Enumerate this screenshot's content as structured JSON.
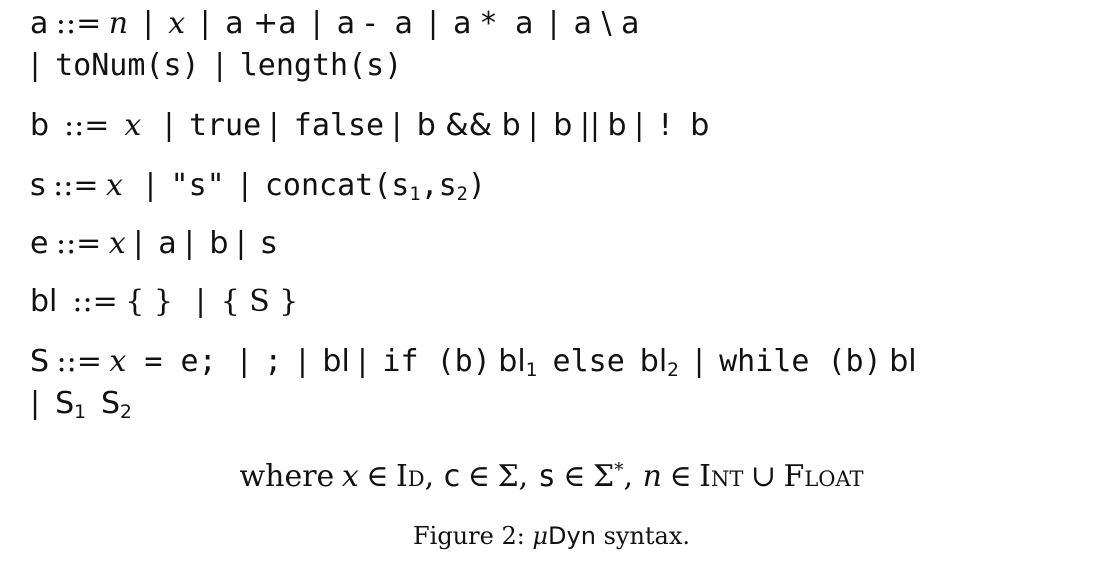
{
  "grammar": {
    "a": {
      "nt": "a",
      "def": "::=",
      "n": "n",
      "x": "x",
      "add": "a +a",
      "sub": "a -  a",
      "mul": "a *  a",
      "div": "a \\ a",
      "tonum": "toNum(s)",
      "length": "length(s)"
    },
    "b": {
      "nt": "b",
      "def": "::=",
      "x": "x",
      "true": "true",
      "false": "false",
      "and": "b && b",
      "or_l": "b",
      "or_op": "||",
      "or_r": "b",
      "not": "!  b"
    },
    "s": {
      "nt": "s",
      "def": "::=",
      "x": "x",
      "lit": "\"s\"",
      "concat_pre": "concat(s",
      "concat_sub1": "1",
      "comma": ",s",
      "concat_sub2": "2",
      "close": ")"
    },
    "e": {
      "nt": "e",
      "def": "::=",
      "x": "x",
      "a": "a",
      "b": "b",
      "s": "s"
    },
    "bl": {
      "nt": "bl",
      "def": "::=",
      "empty": "{ }",
      "block": "{ S }"
    },
    "S": {
      "nt": "S",
      "def": "::=",
      "x": "x",
      "assign_rest": " = e;",
      "skip": ";",
      "bl": "bl",
      "if": "if (b)",
      "bl1": "bl",
      "bl1_sub": "1",
      "else": "else",
      "bl2": "bl",
      "bl2_sub": "2",
      "while": "while (b)",
      "while_bl": "bl",
      "seq1": "S",
      "seq1_sub": "1",
      "seq2": "S",
      "seq2_sub": "2"
    },
    "bar": "|"
  },
  "where_clause": {
    "where": "where",
    "x": "x",
    "in": "∈",
    "id": "Id",
    "c": "c",
    "sigma": "Σ",
    "s": "s",
    "star": "*",
    "n": "n",
    "int": "Int",
    "union": "∪",
    "float": "Float"
  },
  "caption": {
    "prefix": "Figure 2: ",
    "mu": "μ",
    "dyn": "Dyn",
    "suffix": " syntax."
  }
}
